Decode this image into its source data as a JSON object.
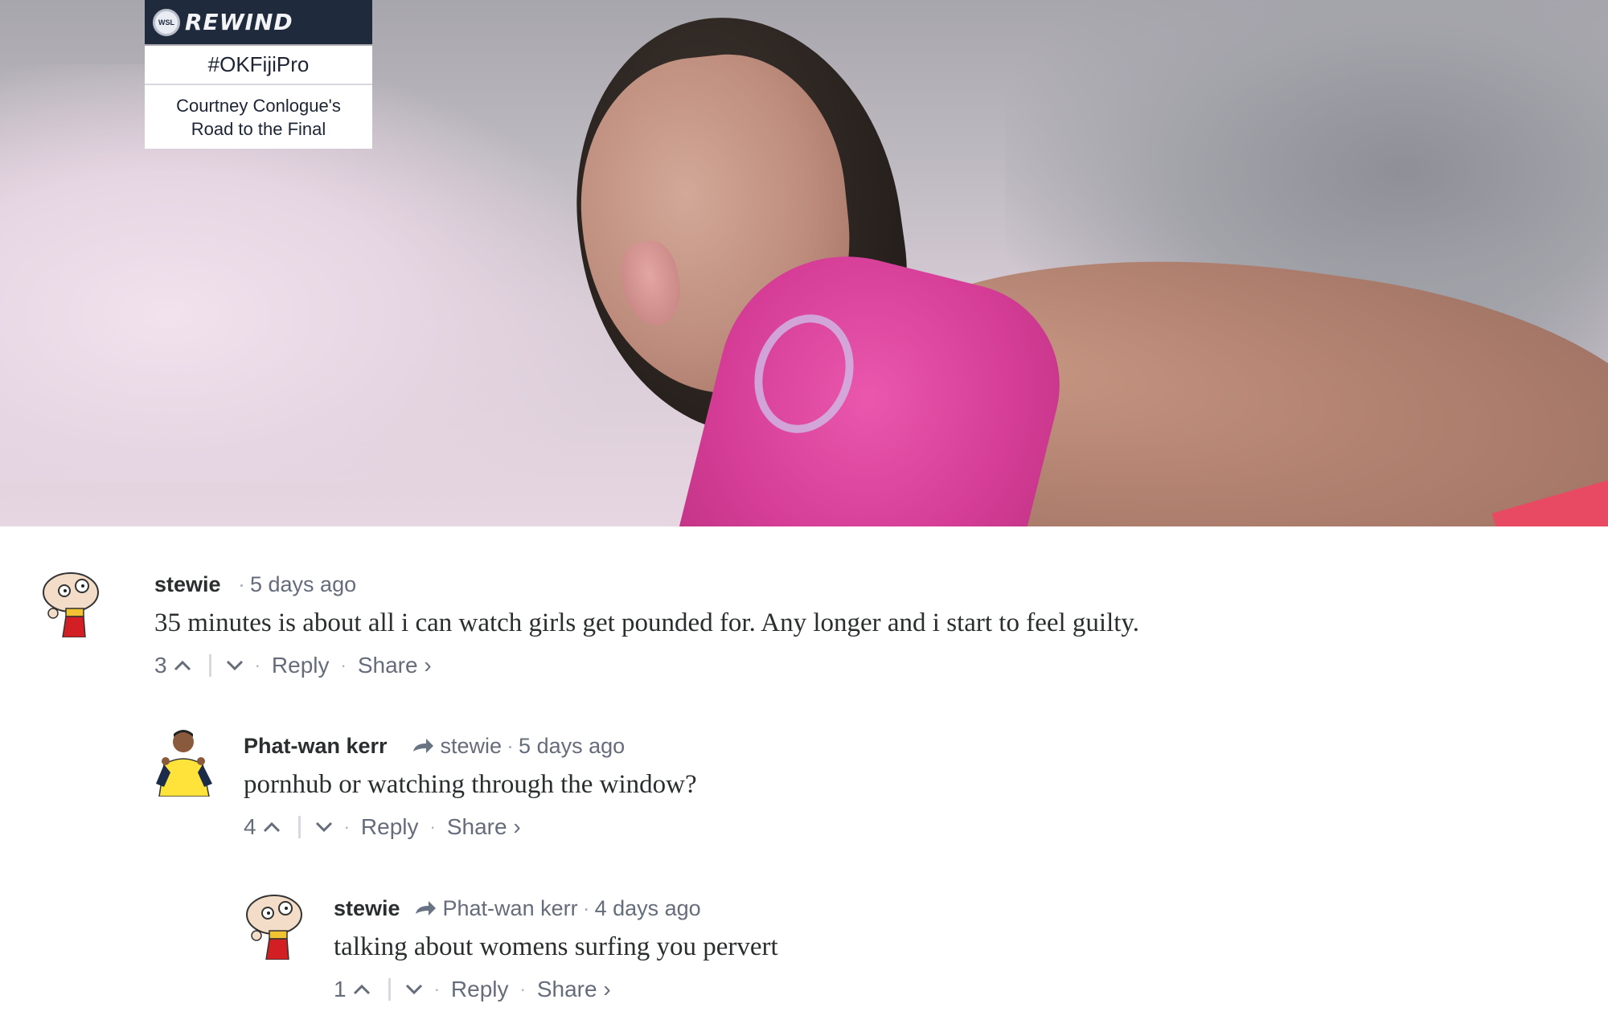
{
  "video": {
    "overlay": {
      "brand": "REWIND",
      "hashtag": "#OKFijiPro",
      "subtitle_line1": "Courtney Conlogue's",
      "subtitle_line2": "Road to the Final"
    }
  },
  "comments": [
    {
      "author": "stewie",
      "reply_to": "",
      "timestamp": "5 days ago",
      "text": "35 minutes is about all i can watch girls get pounded for. Any longer and i start to feel guilty.",
      "votes": "3",
      "reply_label": "Reply",
      "share_label": "Share ›"
    },
    {
      "author": "Phat-wan kerr",
      "reply_to": "stewie",
      "timestamp": "5 days ago",
      "text": "pornhub or watching through the window?",
      "votes": "4",
      "reply_label": "Reply",
      "share_label": "Share ›"
    },
    {
      "author": "stewie",
      "reply_to": "Phat-wan kerr",
      "timestamp": "4 days ago",
      "text": "talking about womens surfing you pervert",
      "votes": "1",
      "reply_label": "Reply",
      "share_label": "Share ›"
    }
  ],
  "icons": {
    "upvote": "chevron-up-icon",
    "downvote": "chevron-down-icon",
    "reply_arrow": "reply-arrow-icon",
    "separator_dot": "·"
  },
  "colors": {
    "overlay_header": "#1f2a3d",
    "author": "#2a2e2e",
    "meta": "#656c7a",
    "jersey": "#d53d96"
  }
}
